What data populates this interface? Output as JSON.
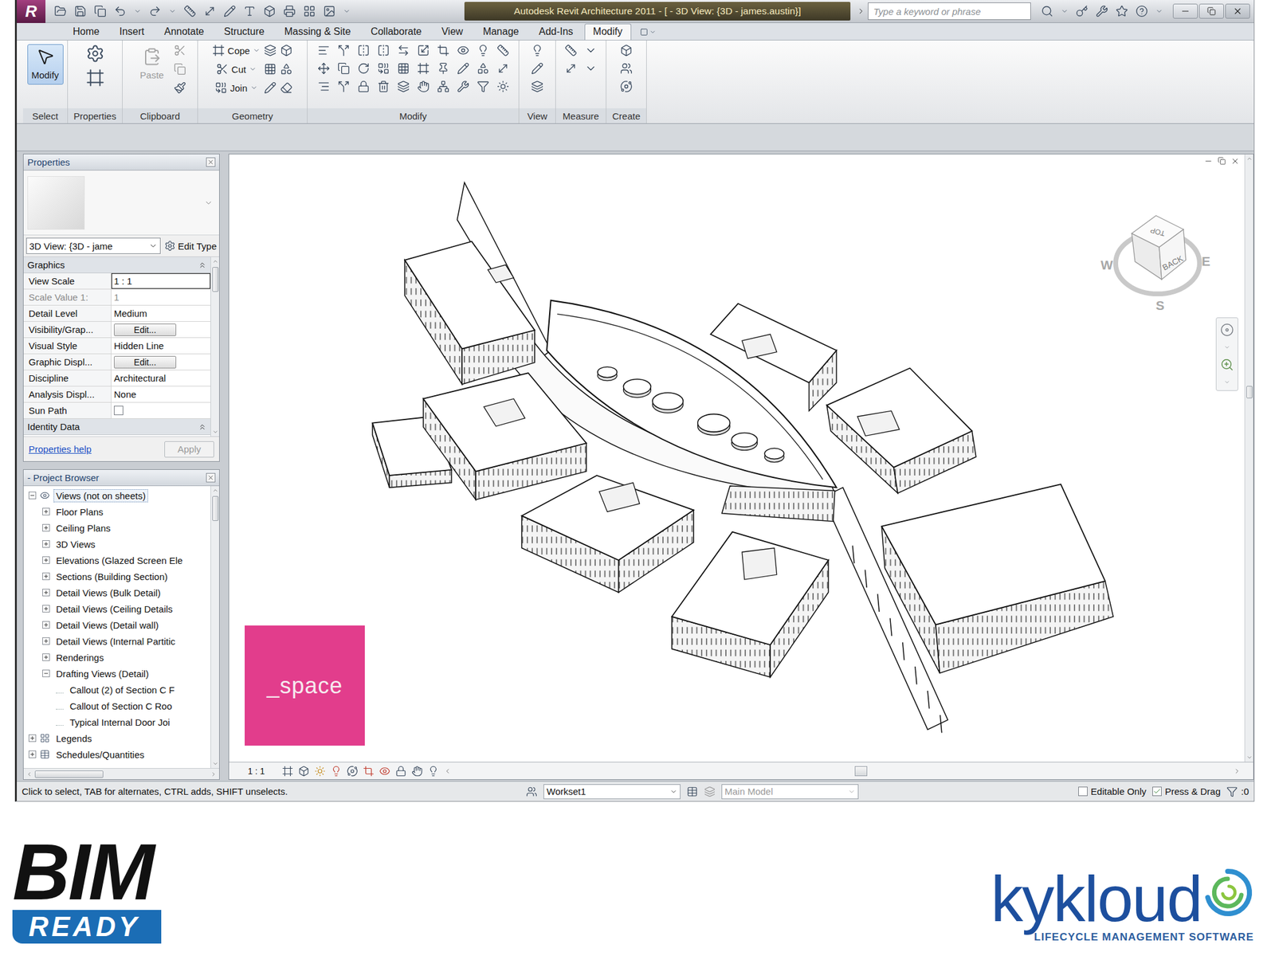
{
  "window": {
    "app_button": "R",
    "title": "Autodesk Revit Architecture 2011 - [ - 3D View: {3D - james.austin}]",
    "search_placeholder": "Type a keyword or phrase"
  },
  "ribbon_tabs": [
    {
      "label": "Home",
      "selected": false
    },
    {
      "label": "Insert",
      "selected": false
    },
    {
      "label": "Annotate",
      "selected": false
    },
    {
      "label": "Structure",
      "selected": false
    },
    {
      "label": "Massing & Site",
      "selected": false
    },
    {
      "label": "Collaborate",
      "selected": false
    },
    {
      "label": "View",
      "selected": false
    },
    {
      "label": "Manage",
      "selected": false
    },
    {
      "label": "Add-Ins",
      "selected": false
    },
    {
      "label": "Modify",
      "selected": true
    }
  ],
  "ribbon_panels": [
    {
      "label": "Select",
      "kind": "select",
      "buttons": [
        {
          "label": "Modify",
          "selected": true,
          "disabled": false
        }
      ]
    },
    {
      "label": "Properties",
      "kind": "icons",
      "buttons": []
    },
    {
      "label": "Clipboard",
      "kind": "clipboard",
      "buttons": [
        {
          "label": "Paste",
          "selected": false,
          "disabled": true
        }
      ]
    },
    {
      "label": "Geometry",
      "kind": "geometry",
      "buttons": [
        {
          "label": "Cope",
          "selected": false,
          "disabled": false
        },
        {
          "label": "Cut",
          "selected": false,
          "disabled": false
        },
        {
          "label": "Join",
          "selected": false,
          "disabled": false
        }
      ]
    },
    {
      "label": "Modify",
      "kind": "icons",
      "buttons": []
    },
    {
      "label": "View",
      "kind": "icons",
      "buttons": []
    },
    {
      "label": "Measure",
      "kind": "icons",
      "buttons": []
    },
    {
      "label": "Create",
      "kind": "icons",
      "buttons": []
    }
  ],
  "properties": {
    "title": "Properties",
    "type_selector": "3D View: {3D - jame",
    "edit_type": "Edit Type",
    "groups": [
      {
        "label": "Graphics",
        "expanded": true,
        "rows": [
          {
            "name": "View Scale",
            "value": "1 : 1",
            "kind": "field",
            "disabled": false,
            "selected": true,
            "checked": false
          },
          {
            "name": "Scale Value 1:",
            "value": "1",
            "kind": "field",
            "disabled": true,
            "selected": false,
            "checked": false
          },
          {
            "name": "Detail Level",
            "value": "Medium",
            "kind": "field",
            "disabled": false,
            "selected": false,
            "checked": false
          },
          {
            "name": "Visibility/Grap...",
            "value": "Edit...",
            "kind": "button",
            "disabled": false,
            "selected": false,
            "checked": false
          },
          {
            "name": "Visual Style",
            "value": "Hidden Line",
            "kind": "field",
            "disabled": false,
            "selected": false,
            "checked": false
          },
          {
            "name": "Graphic Displ...",
            "value": "Edit...",
            "kind": "button",
            "disabled": false,
            "selected": false,
            "checked": false
          },
          {
            "name": "Discipline",
            "value": "Architectural",
            "kind": "field",
            "disabled": false,
            "selected": false,
            "checked": false
          },
          {
            "name": "Analysis Displ...",
            "value": "None",
            "kind": "field",
            "disabled": false,
            "selected": false,
            "checked": false
          },
          {
            "name": "Sun Path",
            "value": "",
            "kind": "checkbox",
            "disabled": false,
            "selected": false,
            "checked": false
          }
        ]
      },
      {
        "label": "Identity Data",
        "expanded": true,
        "rows": []
      }
    ],
    "help": "Properties help",
    "apply": {
      "label": "Apply",
      "disabled": true
    }
  },
  "project_browser": {
    "title": "Project Browser",
    "items": [
      {
        "label": "Views (not on sheets)",
        "level": 0,
        "has_children": true,
        "expanded": true,
        "selected": true,
        "kind": "views"
      },
      {
        "label": "Floor Plans",
        "level": 1,
        "has_children": true,
        "expanded": false,
        "selected": false,
        "kind": "folder"
      },
      {
        "label": "Ceiling Plans",
        "level": 1,
        "has_children": true,
        "expanded": false,
        "selected": false,
        "kind": "folder"
      },
      {
        "label": "3D Views",
        "level": 1,
        "has_children": true,
        "expanded": false,
        "selected": false,
        "kind": "folder"
      },
      {
        "label": "Elevations (Glazed Screen Ele",
        "level": 1,
        "has_children": true,
        "expanded": false,
        "selected": false,
        "kind": "folder"
      },
      {
        "label": "Sections (Building Section)",
        "level": 1,
        "has_children": true,
        "expanded": false,
        "selected": false,
        "kind": "folder"
      },
      {
        "label": "Detail Views (Bulk Detail)",
        "level": 1,
        "has_children": true,
        "expanded": false,
        "selected": false,
        "kind": "folder"
      },
      {
        "label": "Detail Views (Ceiling Details",
        "level": 1,
        "has_children": true,
        "expanded": false,
        "selected": false,
        "kind": "folder"
      },
      {
        "label": "Detail Views (Detail wall)",
        "level": 1,
        "has_children": true,
        "expanded": false,
        "selected": false,
        "kind": "folder"
      },
      {
        "label": "Detail Views (Internal Partitic",
        "level": 1,
        "has_children": true,
        "expanded": false,
        "selected": false,
        "kind": "folder"
      },
      {
        "label": "Renderings",
        "level": 1,
        "has_children": true,
        "expanded": false,
        "selected": false,
        "kind": "folder"
      },
      {
        "label": "Drafting Views (Detail)",
        "level": 1,
        "has_children": true,
        "expanded": true,
        "selected": false,
        "kind": "folder"
      },
      {
        "label": "Callout (2) of Section C F",
        "level": 2,
        "has_children": false,
        "expanded": false,
        "selected": false,
        "kind": "leaf"
      },
      {
        "label": "Callout of Section C Roo",
        "level": 2,
        "has_children": false,
        "expanded": false,
        "selected": false,
        "kind": "leaf"
      },
      {
        "label": "Typical Internal Door Joi",
        "level": 2,
        "has_children": false,
        "expanded": false,
        "selected": false,
        "kind": "leaf"
      },
      {
        "label": "Legends",
        "level": 0,
        "has_children": true,
        "expanded": false,
        "selected": false,
        "kind": "legend"
      },
      {
        "label": "Schedules/Quantities",
        "level": 0,
        "has_children": true,
        "expanded": false,
        "selected": false,
        "kind": "schedule"
      }
    ]
  },
  "view": {
    "scale": "1 : 1",
    "viewcube": {
      "top": "TOP",
      "face": "BACK"
    },
    "compass": [
      {
        "label": "W"
      },
      {
        "label": "E"
      },
      {
        "label": "S"
      }
    ],
    "watermark": "_space"
  },
  "status_bar": {
    "message": "Click to select, TAB for alternates, CTRL adds, SHIFT unselects.",
    "workset": "Workset1",
    "design_option": {
      "label": "Main Model",
      "disabled": true
    },
    "editable_only": {
      "label": "Editable Only",
      "checked": false
    },
    "press_drag": {
      "label": "Press & Drag",
      "checked": true
    },
    "filter_count": ":0"
  },
  "footer": {
    "bim": "BIM",
    "ready": "READY",
    "brand": "kykloud",
    "tagline": "LIFECYCLE MANAGEMENT SOFTWARE"
  }
}
